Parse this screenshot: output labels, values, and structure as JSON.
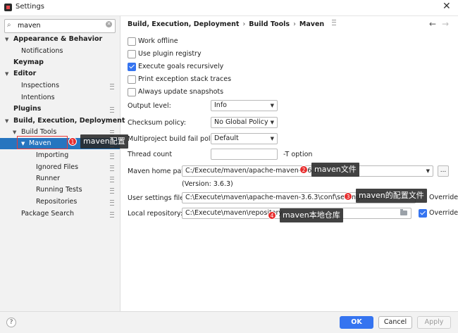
{
  "window": {
    "title": "Settings",
    "close_glyph": "✕"
  },
  "search": {
    "value": "maven",
    "icon": "search-icon"
  },
  "sidebar": {
    "items": [
      {
        "label": "Appearance & Behavior",
        "arrow": "▼"
      },
      {
        "label": "Notifications"
      },
      {
        "label": "Keymap"
      },
      {
        "label": "Editor",
        "arrow": "▼"
      },
      {
        "label": "Inspections"
      },
      {
        "label": "Intentions"
      },
      {
        "label": "Plugins"
      },
      {
        "label": "Build, Execution, Deployment",
        "arrow": "▼"
      },
      {
        "label": "Build Tools",
        "arrow": "▼"
      },
      {
        "label": "Maven",
        "arrow": "▼"
      },
      {
        "label": "Importing"
      },
      {
        "label": "Ignored Files"
      },
      {
        "label": "Runner"
      },
      {
        "label": "Running Tests"
      },
      {
        "label": "Repositories"
      },
      {
        "label": "Package Search"
      }
    ]
  },
  "breadcrumb": {
    "items": [
      "Build, Execution, Deployment",
      "Build Tools",
      "Maven"
    ],
    "separator": "›",
    "back": "←",
    "forward": "→"
  },
  "checkboxes": [
    {
      "label": "Work offline",
      "checked": false
    },
    {
      "label": "Use plugin registry",
      "checked": false
    },
    {
      "label": "Execute goals recursively",
      "checked": true
    },
    {
      "label": "Print exception stack traces",
      "checked": false
    },
    {
      "label": "Always update snapshots",
      "checked": false
    }
  ],
  "fields": {
    "output_level": {
      "label": "Output level:",
      "value": "Info"
    },
    "checksum_policy": {
      "label": "Checksum policy:",
      "value": "No Global Policy"
    },
    "fail_policy": {
      "label": "Multiproject build fail policy:",
      "value": "Default"
    },
    "thread_count": {
      "label": "Thread count",
      "value": "",
      "suffix": "-T option"
    },
    "maven_home": {
      "label": "Maven home path:",
      "value": "C:/Execute/maven/apache-maven-3.6.3",
      "version": "(Version: 3.6.3)",
      "browse": "..."
    },
    "user_settings": {
      "label": "User settings file:",
      "value": "C:\\Execute\\maven\\apache-maven-3.6.3\\conf\\settings.xml",
      "override_label": "Override",
      "override_checked": false
    },
    "local_repo": {
      "label": "Local repository:",
      "value": "C:\\Execute\\maven\\repository",
      "override_label": "Override",
      "override_checked": true
    }
  },
  "annotations": [
    {
      "number": "1",
      "text": "maven配置"
    },
    {
      "number": "2",
      "text": "maven文件"
    },
    {
      "number": "3",
      "text": "maven的配置文件"
    },
    {
      "number": "4",
      "text": "maven本地仓库"
    }
  ],
  "buttons": {
    "ok": "OK",
    "cancel": "Cancel",
    "apply": "Apply",
    "help": "?"
  },
  "colors": {
    "accent": "#3574f0",
    "selection": "#2675bf",
    "annotation": "#e82d2d"
  }
}
